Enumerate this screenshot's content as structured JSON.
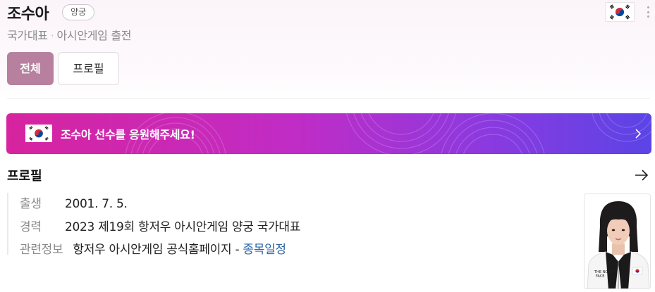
{
  "header": {
    "name": "조수아",
    "sport_badge": "양궁",
    "subtitle_part1": "국가대표",
    "subtitle_separator": "·",
    "subtitle_part2": "아시안게임 출전",
    "flag_icon": "korea-flag-icon"
  },
  "tabs": [
    {
      "label": "전체",
      "active": true
    },
    {
      "label": "프로필",
      "active": false
    }
  ],
  "banner": {
    "text": "조수아 선수를 응원해주세요!",
    "gradient_colors": [
      "#d7249f",
      "#c02cc6",
      "#8a3ae0",
      "#5b44e6"
    ]
  },
  "profile": {
    "title": "프로필",
    "rows": [
      {
        "label": "출생",
        "value": "2001. 7. 5."
      },
      {
        "label": "경력",
        "value": "2023 제19회 항저우 아시안게임 양궁 국가대표"
      },
      {
        "label": "관련정보",
        "value": "항저우 아시안게임 공식홈페이지 -",
        "link": "종목일정"
      }
    ]
  },
  "colors": {
    "accent_tab": "#b7809f",
    "link": "#2a63a8"
  }
}
